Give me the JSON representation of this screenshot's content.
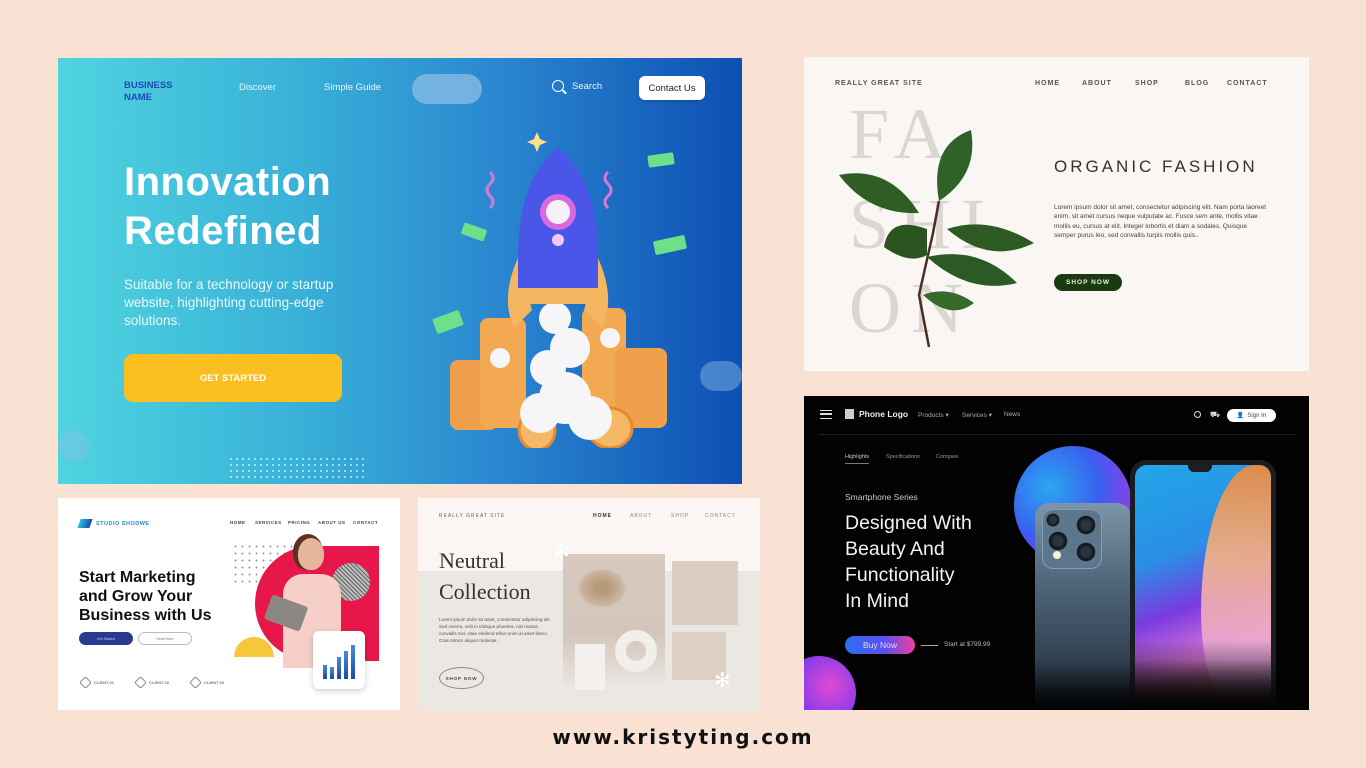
{
  "card_innovation": {
    "brand": "BUSINESS NAME",
    "nav": [
      "Discover",
      "Simple Guide"
    ],
    "search_label": "Search",
    "contact_button": "Contact Us",
    "headline_line1": "Innovation",
    "headline_line2": "Redefined",
    "subtitle": "Suitable for a technology or startup website, highlighting cutting-edge solutions.",
    "cta": "GET STARTED",
    "colors": {
      "gradient_start": "#4fd4df",
      "gradient_end": "#0d4fb4",
      "cta": "#fbbf1f",
      "brand": "#1f49b8"
    }
  },
  "card_fashion": {
    "site": "REALLY GREAT SITE",
    "nav": [
      "HOME",
      "ABOUT",
      "SHOP",
      "BLOG",
      "CONTACT"
    ],
    "background_word": [
      "FA",
      "SHI",
      "ON"
    ],
    "title": "ORGANIC FASHION",
    "body": "Lorem ipsum dolor sit amet, consectetur adipiscing elit. Nam porta laoreet enim, sit amet cursus neque vulputate ac. Fusce sem ante, mollis vitae mollis eu, cursus at elit. Integer lobortis et diam a sodales. Quisque semper purus leo, sed convallis turpis mollis quis..",
    "cta": "SHOP NOW",
    "colors": {
      "cta": "#1b3a12"
    }
  },
  "card_phone": {
    "logo": "Phone Logo",
    "nav": [
      "Products ▾",
      "Services ▾",
      "News"
    ],
    "signin": "Sign In",
    "tabs": [
      "Highlights",
      "Specifications",
      "Compare"
    ],
    "active_tab": "Highlights",
    "series": "Smartphone Series",
    "headline": [
      "Designed With",
      "Beauty And",
      "Functionality",
      "In Mind"
    ],
    "buy_button": "Buy Now",
    "price": "Start at $799.99"
  },
  "card_marketing": {
    "logo": "STUDIO SHODWE",
    "nav": [
      "HOME",
      "SERVICES",
      "PRICING",
      "ABOUT US",
      "CONTACT"
    ],
    "headline": [
      "Start Marketing",
      "and Grow Your",
      "Business with Us"
    ],
    "primary_button": "Get Started",
    "secondary_button": "Read More",
    "clients": [
      "CLIENT 01",
      "CLIENT 02",
      "CLIENT 03"
    ],
    "chart_bars": [
      0.35,
      0.3,
      0.55,
      0.7,
      0.85
    ],
    "colors": {
      "accent": "#e8174a",
      "button": "#2a3a90"
    }
  },
  "card_neutral": {
    "site": "REALLY GREAT SITE",
    "nav": [
      "HOME",
      "ABOUT",
      "SHOP",
      "CONTACT"
    ],
    "active_nav": "HOME",
    "title_line1": "Neutral",
    "title_line2": "Collection",
    "body": "Lorem ipsum dolor sit amet, consectetur adipiscing elit. Sed viverra, velit in tristique pharetra, nisi massa convallis nisl, vitae eleifend tellus enim at amet libero. Cras rutrum aliquet molestie.",
    "cta": "SHOP NOW"
  },
  "footer": {
    "url": "www.kristyting.com"
  }
}
